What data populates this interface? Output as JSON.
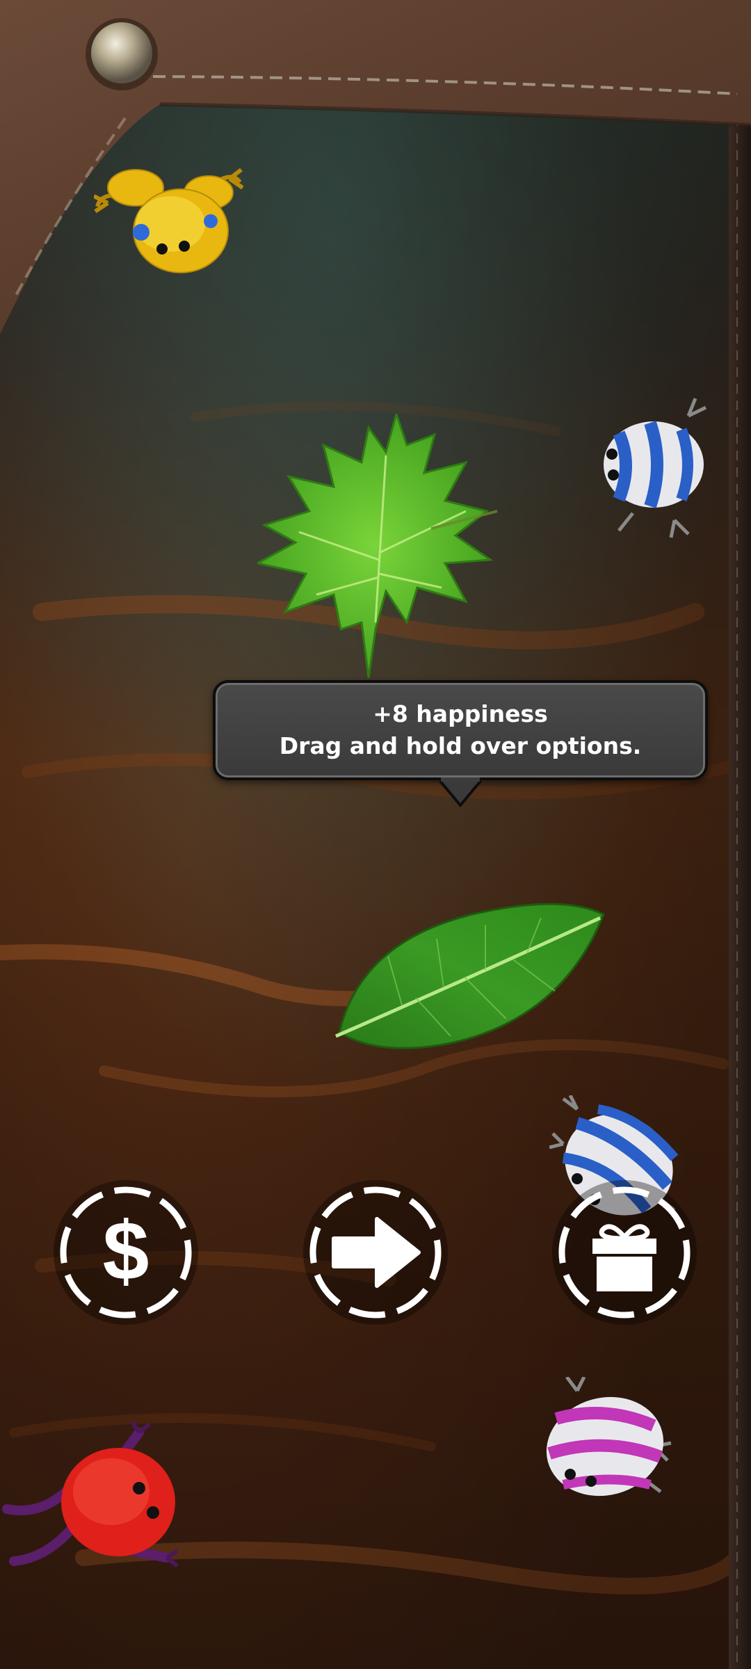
{
  "tooltip": {
    "line1": "+8 happiness",
    "line2": "Drag and hold over options."
  },
  "actions": [
    {
      "name": "shop",
      "icon": "dollar-icon",
      "glyph": "$"
    },
    {
      "name": "next",
      "icon": "arrow-right-icon"
    },
    {
      "name": "gift",
      "icon": "gift-icon"
    }
  ],
  "colors": {
    "tooltip_bg": "#444444",
    "button_ring": "#ffffff",
    "frog_yellow": "#f2c418",
    "frog_blue_stripe": "#2a5fc8",
    "frog_pink_stripe": "#c236b8",
    "frog_red": "#e0201a",
    "leaf_green": "#4cb82a"
  }
}
